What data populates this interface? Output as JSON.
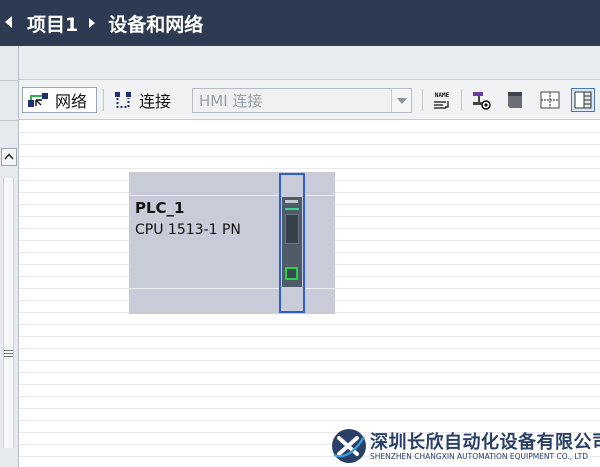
{
  "breadcrumb": {
    "project": "项目1",
    "view": "设备和网络"
  },
  "toolbar": {
    "network_label": "网络",
    "connection_label": "连接",
    "connection_type": "HMI 连接",
    "name_icon_text": "NAME"
  },
  "device": {
    "name": "PLC_1",
    "type": "CPU 1513-1 PN"
  },
  "watermark": {
    "company_cn": "深圳长欣自动化设备有限公司",
    "company_en": "SHENZHEN CHANGXIN AUTOMATION EQUIPMENT CO., LTD"
  },
  "colors": {
    "title_bar": "#2d3a52",
    "device_body": "#c9ccd8",
    "selection": "#2f5fc2",
    "port_led": "#27d04b",
    "brand": "#2b4066"
  }
}
